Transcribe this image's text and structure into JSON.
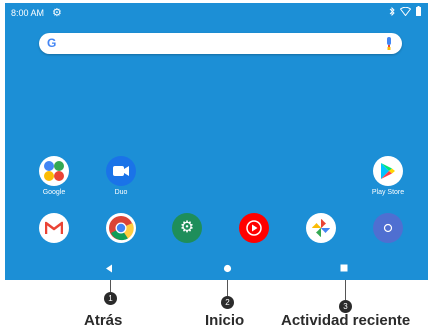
{
  "status_bar": {
    "time": "8:00 AM"
  },
  "search_bar": {
    "logo_letter": "G"
  },
  "apps_row": [
    {
      "label": "Google"
    },
    {
      "label": "Duo"
    },
    {
      "label": "Play Store"
    }
  ],
  "dock": [
    {
      "name": "Gmail"
    },
    {
      "name": "Chrome"
    },
    {
      "name": "Settings"
    },
    {
      "name": "YouTube Music"
    },
    {
      "name": "Photos"
    },
    {
      "name": "App launcher"
    }
  ],
  "callouts": [
    {
      "number": "1",
      "label": "Atrás"
    },
    {
      "number": "2",
      "label": "Inicio"
    },
    {
      "number": "3",
      "label": "Actividad reciente"
    }
  ],
  "colors": {
    "wallpaper": "#1c8fd6",
    "dark": "#2b2b2b"
  }
}
